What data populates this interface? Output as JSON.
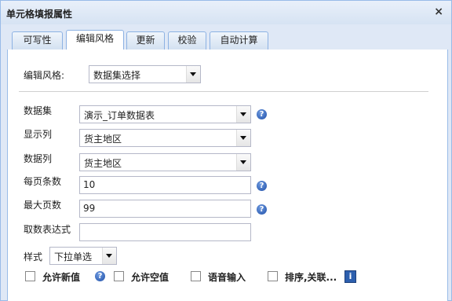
{
  "window": {
    "title": "单元格填报属性",
    "close_glyph": "×"
  },
  "tabs": [
    {
      "label": "可写性"
    },
    {
      "label": "编辑风格"
    },
    {
      "label": "更新"
    },
    {
      "label": "校验"
    },
    {
      "label": "自动计算"
    }
  ],
  "edit_style": {
    "label": "编辑风格:",
    "value": "数据集选择"
  },
  "dataset": {
    "label": "数据集",
    "value": "演示_订单数据表"
  },
  "display_column": {
    "label": "显示列",
    "value": "货主地区"
  },
  "data_column": {
    "label": "数据列",
    "value": "货主地区"
  },
  "page_size": {
    "label": "每页条数",
    "value": "10"
  },
  "max_pages": {
    "label": "最大页数",
    "value": "99"
  },
  "expression": {
    "label": "取数表达式",
    "value": ""
  },
  "style": {
    "label": "样式",
    "value": "下拉单选"
  },
  "checkboxes": [
    {
      "label": "允许新值",
      "checked": false
    },
    {
      "label": "允许空值",
      "checked": false
    },
    {
      "label": "语音输入",
      "checked": false
    },
    {
      "label": "排序,关联...",
      "checked": false
    }
  ],
  "icons": {
    "help": "?",
    "info": "i"
  }
}
